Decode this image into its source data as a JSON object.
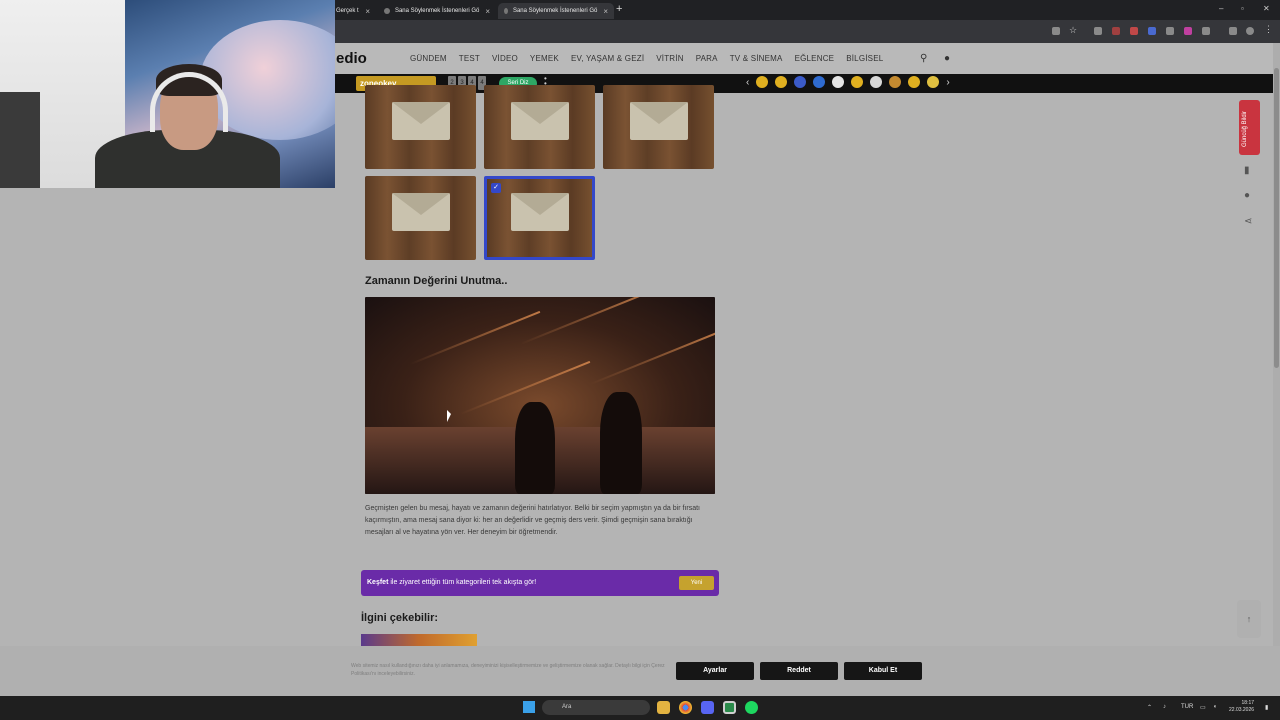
{
  "browser": {
    "tabs": [
      {
        "label": "Gerçek t"
      },
      {
        "label": "Sana Söylenmek İstenenleri Gö"
      },
      {
        "label": "Sana Söylenmek İstenenleri Gö"
      }
    ],
    "new_tab": "+"
  },
  "site": {
    "logo": "edio",
    "nav": [
      "GÜNDEM",
      "TEST",
      "VİDEO",
      "YEMEK",
      "EV, YAŞAM & GEZİ",
      "VİTRİN",
      "PARA",
      "TV & SİNEMA",
      "EĞLENCE",
      "BİLGİSEL"
    ]
  },
  "gamebar": {
    "zone_label": "zoneokey",
    "digits": [
      "2",
      "3",
      "4",
      "4"
    ],
    "seri_label": "Seri Diz",
    "emoji_colors": [
      "#e0b020",
      "#e0b020",
      "#3b5bc9",
      "#2f6bd0",
      "#e5e5e5",
      "#e0b020",
      "#d8d8d8",
      "#c48a30",
      "#e0b020",
      "#e0c040"
    ]
  },
  "content": {
    "section_title": "Zamanın Değerini Unutma..",
    "paragraph": "Geçmişten gelen bu mesaj, hayatı ve zamanın değerini hatırlatıyor. Belki bir seçim yapmıştın ya da bir fırsatı kaçırmıştın, ama mesaj sana diyor ki: her an değerlidir ve geçmiş ders verir. Şimdi geçmişin sana bıraktığı mesajları al ve hayatına yön ver. Her deneyim bir öğretmendir.",
    "kesfet_bold": "Keşfet",
    "kesfet_rest": " ile ziyaret ettiğin tüm kategorileri tek akışta gör!",
    "kesfet_button": "Yeni",
    "related_title": "İlgini çekebilir:",
    "selected_index": 4
  },
  "sidebar": {
    "gunc_label": "Güncüğ Bildir",
    "to_top": "↑"
  },
  "cookie": {
    "text": "Web sitemiz nasıl kullandığınızı daha iyi anlamamıza, deneyiminizi kişiselleştirmemize ve geliştirmemize olanak sağlar. Detaylı bilgi için Çerez Politikası'nı inceleyebilirsiniz.",
    "settings": "Ayarlar",
    "reject": "Reddet",
    "accept": "Kabul Et"
  },
  "taskbar": {
    "search_placeholder": "Ara",
    "lang": "TUR",
    "time": "18:17",
    "date": "22.03.2026"
  }
}
